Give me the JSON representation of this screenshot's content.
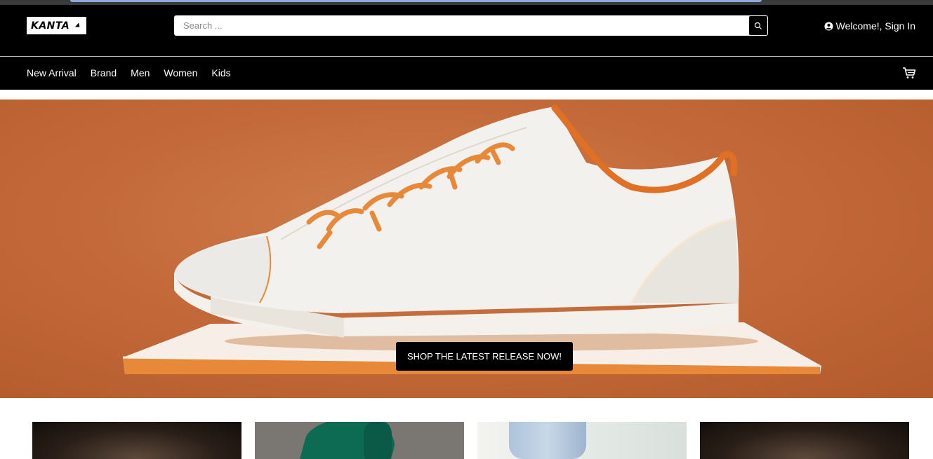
{
  "brand": {
    "logo_text": "KANTA"
  },
  "search": {
    "placeholder": "Search ...",
    "icon": "search-icon"
  },
  "account": {
    "label": "Welcome!, Sign In",
    "icon": "user-circle-icon"
  },
  "nav": {
    "items": [
      "New Arrival",
      "Brand",
      "Men",
      "Women",
      "Kids"
    ],
    "cart_icon": "cart-icon"
  },
  "hero": {
    "cta_label": "SHOP THE LATEST RELEASE NOW!"
  },
  "colors": {
    "header_bg": "#000000",
    "hero_bg": "#c46a3a",
    "accent_orange": "#e8893a",
    "cta_bg": "#000000"
  },
  "product_cards": [
    {
      "name": "card-dark-1"
    },
    {
      "name": "card-green-shoe"
    },
    {
      "name": "card-jeans"
    },
    {
      "name": "card-dark-2"
    }
  ]
}
